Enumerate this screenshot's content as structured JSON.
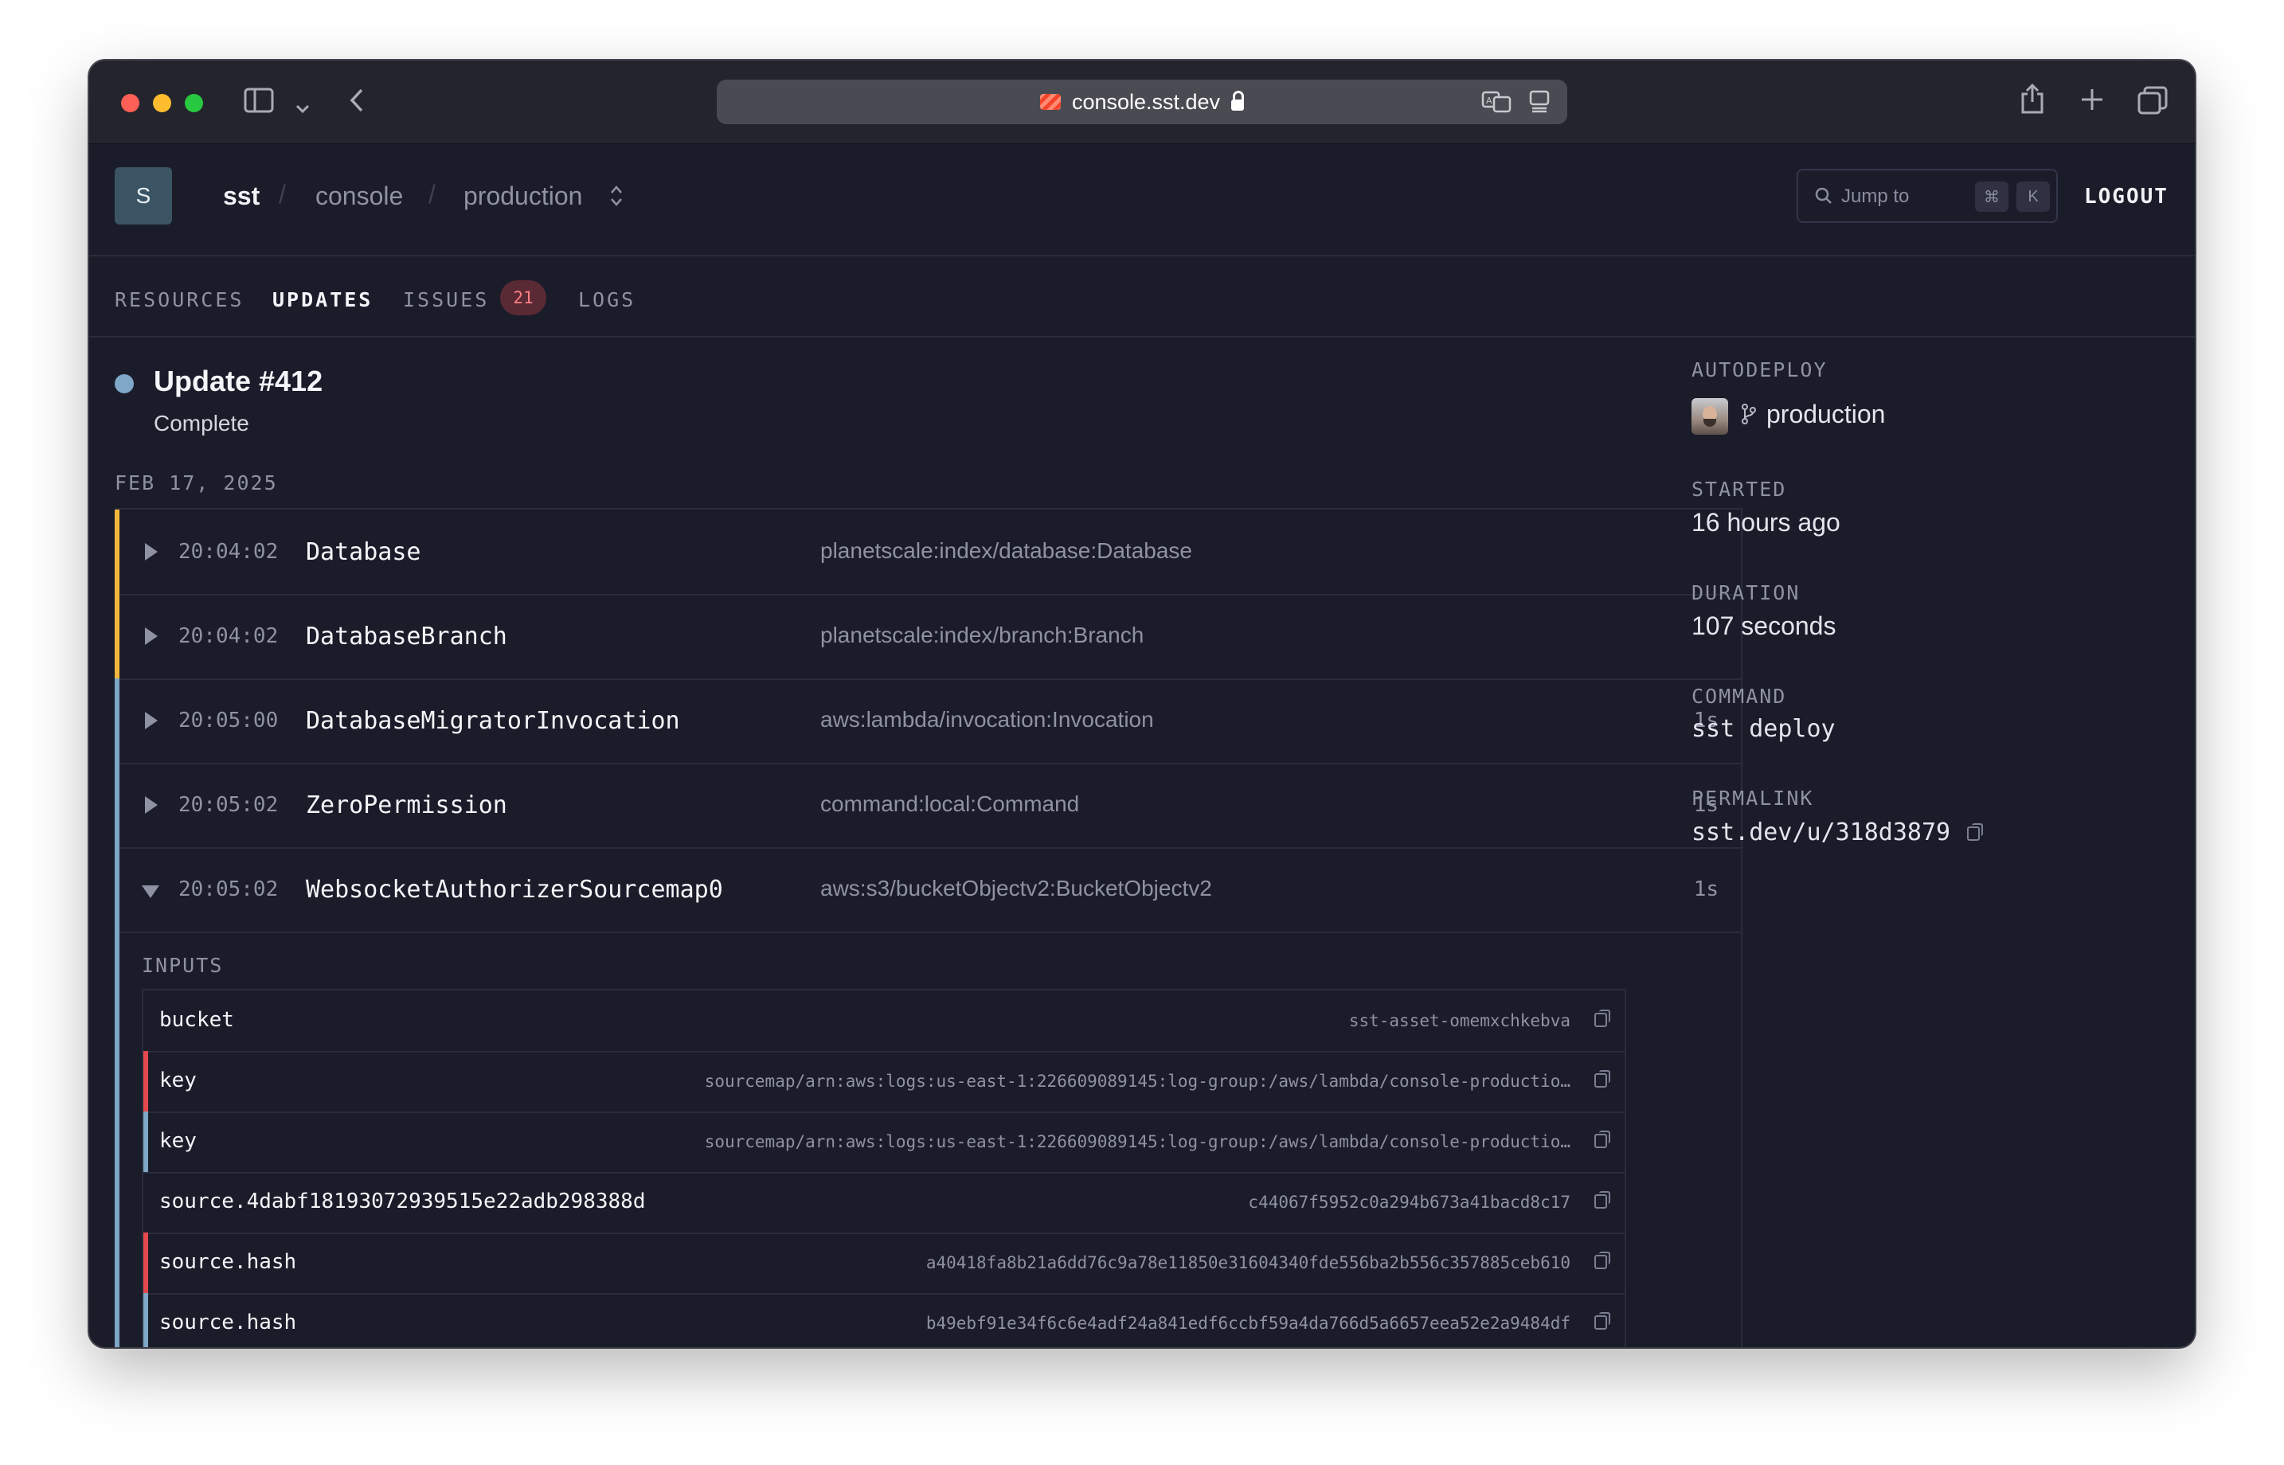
{
  "browser": {
    "url": "console.sst.dev"
  },
  "header": {
    "logo_letter": "S",
    "crumbs": [
      "sst",
      "console",
      "production"
    ],
    "jump_placeholder": "Jump to",
    "jump_keys": [
      "⌘",
      "K"
    ],
    "logout": "LOGOUT"
  },
  "tabs": {
    "resources": "RESOURCES",
    "updates": "UPDATES",
    "issues": "ISSUES",
    "issues_count": "21",
    "logs": "LOGS",
    "active": "updates"
  },
  "update": {
    "title": "Update #412",
    "status": "Complete",
    "date": "FEB 17, 2025"
  },
  "resources": [
    {
      "time": "20:04:02",
      "name": "Database",
      "urn": "planetscale:index/database:Database",
      "duration": "",
      "accent": "#f1b63b",
      "expanded": false
    },
    {
      "time": "20:04:02",
      "name": "DatabaseBranch",
      "urn": "planetscale:index/branch:Branch",
      "duration": "",
      "accent": "#f1b63b",
      "expanded": false
    },
    {
      "time": "20:05:00",
      "name": "DatabaseMigratorInvocation",
      "urn": "aws:lambda/invocation:Invocation",
      "duration": "1s",
      "accent": "#7ea7c8",
      "expanded": false
    },
    {
      "time": "20:05:02",
      "name": "ZeroPermission",
      "urn": "command:local:Command",
      "duration": "1s",
      "accent": "#7ea7c8",
      "expanded": false
    },
    {
      "time": "20:05:02",
      "name": "WebsocketAuthorizerSourcemap0",
      "urn": "aws:s3/bucketObjectv2:BucketObjectv2",
      "duration": "1s",
      "accent": "#7ea7c8",
      "expanded": true
    }
  ],
  "inputs": {
    "label": "INPUTS",
    "rows": [
      {
        "key": "bucket",
        "value": "sst-asset-omemxchkebva",
        "accent": ""
      },
      {
        "key": "key",
        "value": "sourcemap/arn:aws:logs:us-east-1:226609089145:log-group:/aws/lambda/console-productio…",
        "accent": "#e5484d"
      },
      {
        "key": "key",
        "value": "sourcemap/arn:aws:logs:us-east-1:226609089145:log-group:/aws/lambda/console-productio…",
        "accent": "#7ea7c8"
      },
      {
        "key": "source.4dabf18193072939515e22adb298388d",
        "value": "c44067f5952c0a294b673a41bacd8c17",
        "accent": ""
      },
      {
        "key": "source.hash",
        "value": "a40418fa8b21a6dd76c9a78e11850e31604340fde556ba2b556c357885ceb610",
        "accent": "#e5484d"
      },
      {
        "key": "source.hash",
        "value": "b49ebf91e34f6c6e4adf24a841edf6ccbf59a4da766d5a6657eea52e2a9484df",
        "accent": "#7ea7c8"
      }
    ]
  },
  "sidebar": {
    "autodeploy_label": "AUTODEPLOY",
    "autodeploy_branch": "production",
    "started_label": "STARTED",
    "started_value": "16 hours ago",
    "duration_label": "DURATION",
    "duration_value": "107 seconds",
    "command_label": "COMMAND",
    "command_value": "sst deploy",
    "permalink_label": "PERMALINK",
    "permalink_value": "sst.dev/u/318d3879"
  },
  "colors": {
    "background": "#1b1c2a",
    "status_complete": "#7ea7c8",
    "accent_yellow": "#f1b63b",
    "accent_red": "#e5484d",
    "badge_text": "#ff7e86"
  }
}
